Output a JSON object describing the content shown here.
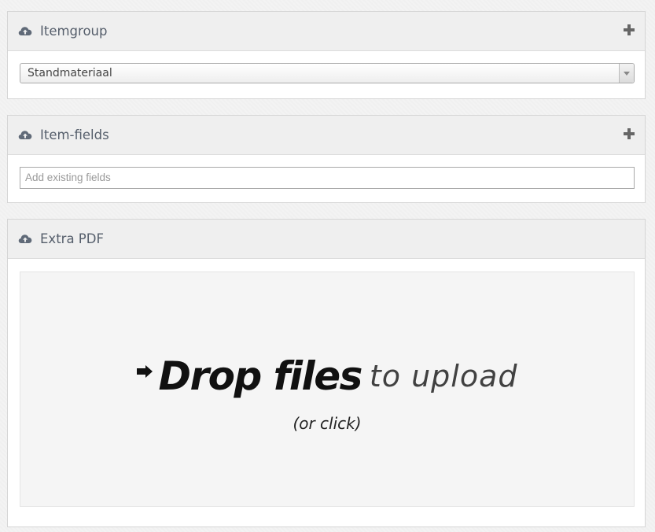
{
  "widgets": {
    "itemgroup": {
      "title": "Itemgroup",
      "select_value": "Standmateriaal"
    },
    "itemfields": {
      "title": "Item-fields",
      "input_placeholder": "Add existing fields",
      "input_value": ""
    },
    "extrapdf": {
      "title": "Extra PDF",
      "dropzone": {
        "main_text": "Drop files",
        "secondary_text": "to upload",
        "sub_text": "(or click)"
      }
    }
  },
  "icons": {
    "header_icon": "cloud-upload-icon",
    "add_icon": "plus-icon",
    "dropzone_arrow": "arrow-right-icon"
  },
  "colors": {
    "header_text": "#555e6b",
    "header_bg": "#efefef",
    "dropzone_bg": "#f5f5f5"
  }
}
